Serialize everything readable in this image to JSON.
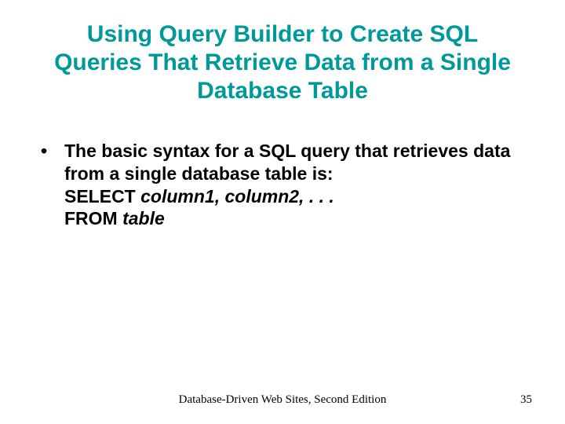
{
  "title": "Using Query Builder to Create SQL Queries That Retrieve Data from a Single Database Table",
  "bullet": {
    "line1": "The basic syntax for a SQL query that retrieves data from a single database table is:",
    "select_word": "SELECT ",
    "select_cols": "column1, column2, . . .",
    "from_word": "FROM ",
    "from_table": "table"
  },
  "footer": {
    "center": "Database-Driven Web Sites, Second Edition",
    "page": "35"
  }
}
